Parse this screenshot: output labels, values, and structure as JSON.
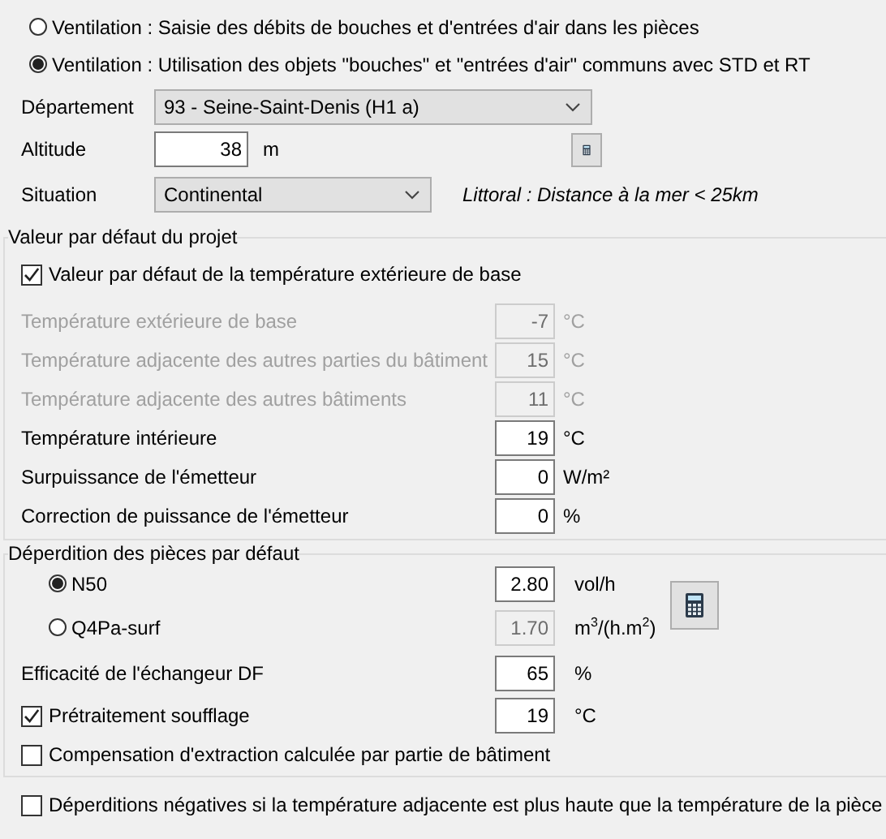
{
  "ventilation_modes": [
    {
      "label": "Ventilation : Saisie des débits de bouches et d'entrées d'air dans les pièces",
      "selected": false
    },
    {
      "label": "Ventilation : Utilisation des objets \"bouches\" et \"entrées d'air\" communs avec STD et RT",
      "selected": true
    }
  ],
  "location": {
    "departement": {
      "label": "Département",
      "value": "93 - Seine-Saint-Denis (H1 a)"
    },
    "altitude": {
      "label": "Altitude",
      "value": "38",
      "unit": "m"
    },
    "situation": {
      "label": "Situation",
      "value": "Continental",
      "note": "Littoral : Distance à la mer < 25km"
    }
  },
  "project_defaults": {
    "title": "Valeur par défaut du projet",
    "default_checkbox": {
      "label": "Valeur par défaut de la température extérieure de base",
      "checked": true
    },
    "fields": [
      {
        "label": "Température extérieure de base",
        "value": "-7",
        "unit": "°C",
        "disabled": true
      },
      {
        "label": "Température adjacente des autres parties du bâtiment",
        "value": "15",
        "unit": "°C",
        "disabled": true
      },
      {
        "label": "Température adjacente des autres bâtiments",
        "value": "11",
        "unit": "°C",
        "disabled": true
      },
      {
        "label": "Température intérieure",
        "value": "19",
        "unit": "°C",
        "disabled": false
      },
      {
        "label": "Surpuissance de l'émetteur",
        "value": "0",
        "unit": "W/m²",
        "disabled": false
      },
      {
        "label": "Correction de puissance de l'émetteur",
        "value": "0",
        "unit": "%",
        "disabled": false
      }
    ]
  },
  "room_losses": {
    "title": "Déperdition des pièces par défaut",
    "methods": [
      {
        "label": "N50",
        "selected": true,
        "value": "2.80",
        "unit": "vol/h"
      },
      {
        "label": "Q4Pa-surf",
        "selected": false,
        "value": "1.70",
        "unit": "m$^{3}$/(h.m$^{2}$)"
      }
    ],
    "exchanger": {
      "label": "Efficacité de l'échangeur DF",
      "value": "65",
      "unit": "%"
    },
    "pretreatment": {
      "label": "Prétraitement soufflage",
      "checked": true,
      "value": "19",
      "unit": "°C"
    },
    "compensation": {
      "label": "Compensation d'extraction calculée par partie de bâtiment",
      "checked": false
    }
  },
  "negative_losses": {
    "label": "Déperditions négatives si la température adjacente est plus haute que la température de la pièce",
    "checked": false
  }
}
